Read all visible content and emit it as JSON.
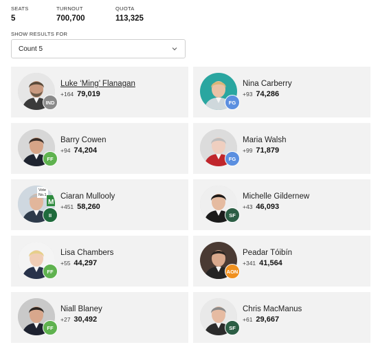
{
  "stats": {
    "seats_label": "SEATS",
    "seats_value": "5",
    "turnout_label": "TURNOUT",
    "turnout_value": "700,700",
    "quota_label": "QUOTA",
    "quota_value": "113,325"
  },
  "filter": {
    "label": "SHOW RESULTS FOR",
    "selected": "Count 5",
    "icon": "chevron-down-icon"
  },
  "party_colors": {
    "IND": "#8a8a8a",
    "FG": "#5b8fe0",
    "FF": "#5fb24f",
    "II": "#1f6b3c",
    "SF": "#2c5e45",
    "AON": "#f0901e"
  },
  "candidates": [
    {
      "name": "Luke ‘Ming’ Flanagan",
      "delta": "+164",
      "votes": "79,019",
      "party": "IND",
      "linked": true
    },
    {
      "name": "Nina Carberry",
      "delta": "+93",
      "votes": "74,286",
      "party": "FG",
      "linked": false
    },
    {
      "name": "Barry Cowen",
      "delta": "+94",
      "votes": "74,204",
      "party": "FF",
      "linked": false
    },
    {
      "name": "Maria Walsh",
      "delta": "+99",
      "votes": "71,879",
      "party": "FG",
      "linked": false
    },
    {
      "name": "Ciaran Mullooly",
      "delta": "+451",
      "votes": "58,260",
      "party": "II",
      "linked": false,
      "photo_text": [
        "Vote",
        "No.1",
        "M"
      ]
    },
    {
      "name": "Michelle Gildernew",
      "delta": "+43",
      "votes": "46,093",
      "party": "SF",
      "linked": false
    },
    {
      "name": "Lisa Chambers",
      "delta": "+55",
      "votes": "44,297",
      "party": "FF",
      "linked": false
    },
    {
      "name": "Peadar Tóibín",
      "delta": "+341",
      "votes": "41,564",
      "party": "AON",
      "linked": false
    },
    {
      "name": "Niall Blaney",
      "delta": "+27",
      "votes": "30,492",
      "party": "FF",
      "linked": false
    },
    {
      "name": "Chris MacManus",
      "delta": "+61",
      "votes": "29,667",
      "party": "SF",
      "linked": false
    }
  ]
}
